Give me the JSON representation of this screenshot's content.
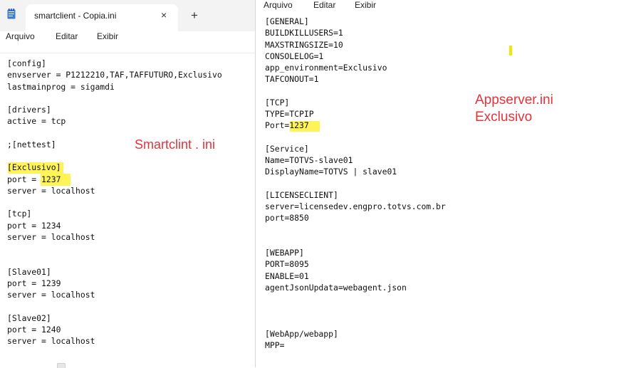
{
  "left_window": {
    "tab_title": "smartclient - Copia.ini",
    "close_icon": "×",
    "new_tab_icon": "+",
    "menu": [
      "Arquivo",
      "Editar",
      "Exibir"
    ],
    "content": "[config]\nenvserver = P1212210,TAF,TAFFUTURO,Exclusivo\nlastmainprog = sigamdi\n\n[drivers]\nactive = tcp\n\n;[nettest]\n\n[Exclusivo]\nport = 1237\nserver = localhost\n\n[tcp]\nport = 1234\nserver = localhost\n\n\n[Slave01]\nport = 1239\nserver = localhost\n\n[Slave02]\nport = 1240\nserver = localhost"
  },
  "right_window": {
    "menu": [
      "Arquivo",
      "Editar",
      "Exibir"
    ],
    "content": "[GENERAL]\nBUILDKILLUSERS=1\nMAXSTRINGSIZE=10\nCONSOLELOG=1\napp_environment=Exclusivo\nTAFCONOUT=1\n\n[TCP]\nTYPE=TCPIP\nPort=1237\n\n[Service]\nName=TOTVS-slave01\nDisplayName=TOTVS | slave01\n\n[LICENSECLIENT]\nserver=licensedev.engpro.totvs.com.br\nport=8850\n\n\n[WEBAPP]\nPORT=8095\nENABLE=01\nagentJsonUpdata=webagent.json\n\n\n\n[WebApp/webapp]\nMPP="
  },
  "annotations": {
    "left_label": "Smartclint . ini",
    "right_label_line1": "Appserver.ini",
    "right_label_line2": "Exclusivo"
  },
  "colors": {
    "highlight": "#fff23a",
    "annotation": "#e5333a"
  }
}
